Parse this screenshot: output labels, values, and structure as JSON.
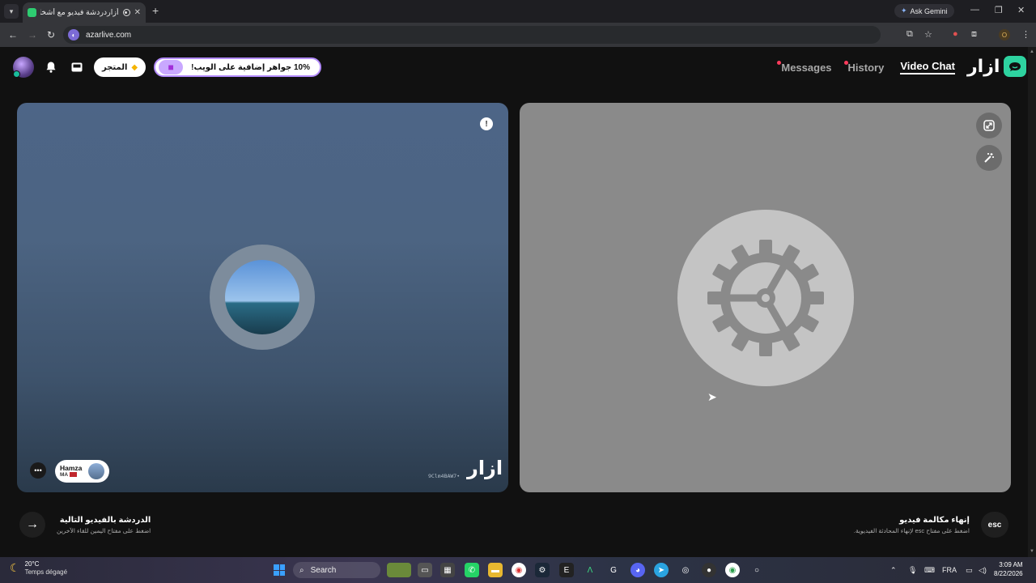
{
  "browser": {
    "tab_title": "أزاردردشة فيديو مع أشخاص",
    "gemini_label": "Ask Gemini",
    "url": "azarlive.com",
    "profile_initial": "O"
  },
  "header": {
    "store_label": "المتجر",
    "gem_offer_label": "10% جواهر إضافية على الويب!",
    "nav": {
      "messages": "Messages",
      "history": "History",
      "video_chat": "Video Chat"
    },
    "logo_text": "ازار"
  },
  "left_panel": {
    "user_name": "Hamza",
    "user_country": "MA",
    "session_id": "9Clm4BAW7•",
    "watermark": "ازار"
  },
  "bottom": {
    "next_title": "الدردشة بالفيديو التالية",
    "next_sub": "اضغط على مفتاح اليمين للقاء الآخرين",
    "end_title": "إنهاء مكالمة فيديو",
    "end_sub": "اضغط على مفتاح esc لإنهاء المحادثة الفيديوية.",
    "esc_label": "esc"
  },
  "taskbar": {
    "temperature": "20°C",
    "weather_condition": "Temps dégagé",
    "search_label": "Search",
    "language": "FRA",
    "time": "3:09 AM",
    "date": "8/22/2026"
  },
  "colors": {
    "accent_green": "#2ed3a0",
    "notification_dot": "#ff3b5c",
    "gem_border": "#b48cff"
  }
}
